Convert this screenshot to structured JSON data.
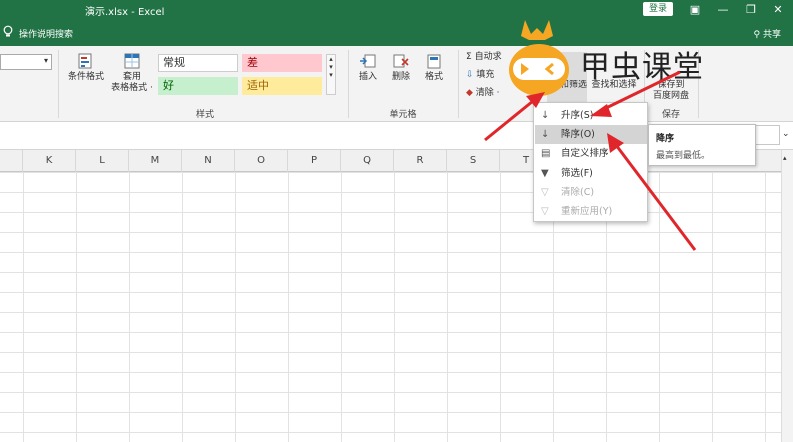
{
  "window": {
    "title": "演示.xlsx  -  Excel",
    "login_label": "登录",
    "controls": [
      "▣",
      "—",
      "❐",
      "✕"
    ]
  },
  "tellbar": {
    "search_label": "操作说明搜索",
    "share_label": "共享"
  },
  "ribbon": {
    "styles_group": {
      "conditional_format": "条件格式",
      "table_format_line1": "套用",
      "table_format_line2": "表格格式 ·",
      "cell_styles": [
        {
          "label": "常规",
          "bg": "#ffffff",
          "fg": "#333333"
        },
        {
          "label": "差",
          "bg": "#ffc7ce",
          "fg": "#9c0006"
        },
        {
          "label": "好",
          "bg": "#c6efce",
          "fg": "#006100"
        },
        {
          "label": "适中",
          "bg": "#ffeb9c",
          "fg": "#9c6500"
        }
      ],
      "group_label": "样式"
    },
    "cells_group": {
      "insert": "插入",
      "delete": "删除",
      "format": "格式",
      "group_label": "单元格"
    },
    "editing_group": {
      "autosum": "自动求",
      "fill": "填充",
      "clear": "清除 ·",
      "sort_filter": "排序和筛选",
      "find_select": "查找和选择"
    },
    "save_group": {
      "save_to_line1": "保存到",
      "save_to_line2": "百度网盘",
      "group_label": "保存"
    }
  },
  "columns": [
    "K",
    "L",
    "M",
    "N",
    "O",
    "P",
    "Q",
    "R",
    "S",
    "T"
  ],
  "sort_menu": {
    "items": [
      {
        "label": "升序(S)",
        "icon": "↓",
        "disabled": false,
        "highlighted": false
      },
      {
        "label": "降序(O)",
        "icon": "↓",
        "disabled": false,
        "highlighted": true
      },
      {
        "label": "自定义排序",
        "icon": "▤",
        "disabled": false,
        "highlighted": false
      },
      {
        "label": "筛选(F)",
        "icon": "▼",
        "disabled": false,
        "highlighted": false
      },
      {
        "label": "清除(C)",
        "icon": "▽",
        "disabled": true,
        "highlighted": false
      },
      {
        "label": "重新应用(Y)",
        "icon": "▽",
        "disabled": true,
        "highlighted": false
      }
    ]
  },
  "tooltip": {
    "title": "降序",
    "description": "最高到最低。"
  },
  "watermark": {
    "text": "甲虫课堂",
    "accent": "#f5a623"
  },
  "colors": {
    "excel_green": "#217346",
    "arrow_red": "#e0262a"
  }
}
